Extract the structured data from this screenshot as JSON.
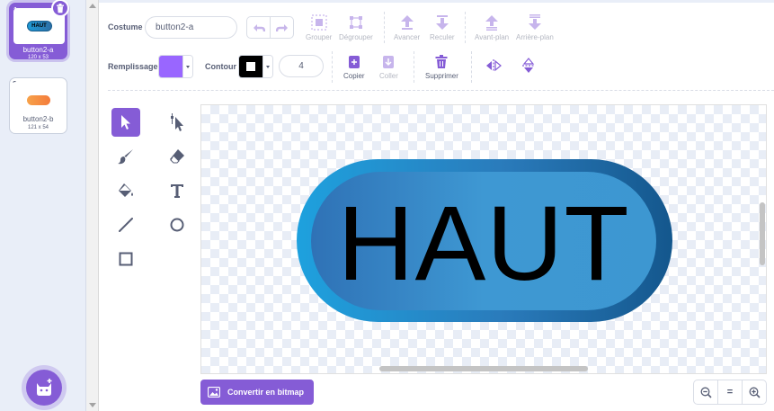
{
  "costumes": [
    {
      "number": "1",
      "name": "button2-a",
      "size": "120 x 53",
      "thumb_text": "HAUT",
      "selected": true
    },
    {
      "number": "2",
      "name": "button2-b",
      "size": "121 x 54",
      "selected": false
    }
  ],
  "toolbar": {
    "costume_label": "Costume",
    "costume_name": "button2-a",
    "group": "Grouper",
    "ungroup": "Dégrouper",
    "forward": "Avancer",
    "backward": "Reculer",
    "front": "Avant-plan",
    "back": "Arrière-plan",
    "fill_label": "Remplissage",
    "outline_label": "Contour",
    "outline_width": "4",
    "copy": "Copier",
    "paste": "Coller",
    "delete": "Supprimer"
  },
  "colors": {
    "accent": "#855cd6",
    "fill": "#9966ff",
    "outline": "#000000"
  },
  "canvas": {
    "costume_text": "HAUT"
  },
  "footer": {
    "convert_bitmap": "Convertir en bitmap",
    "zoom_reset": "="
  },
  "icons": [
    "trash-icon",
    "add-costume-icon",
    "undo-icon",
    "redo-icon",
    "select-icon",
    "reshape-icon",
    "brush-icon",
    "eraser-icon",
    "fill-icon",
    "text-icon",
    "line-icon",
    "circle-icon",
    "rectangle-icon",
    "flip-horizontal-icon",
    "flip-vertical-icon",
    "zoom-out-icon",
    "zoom-in-icon",
    "image-icon"
  ]
}
